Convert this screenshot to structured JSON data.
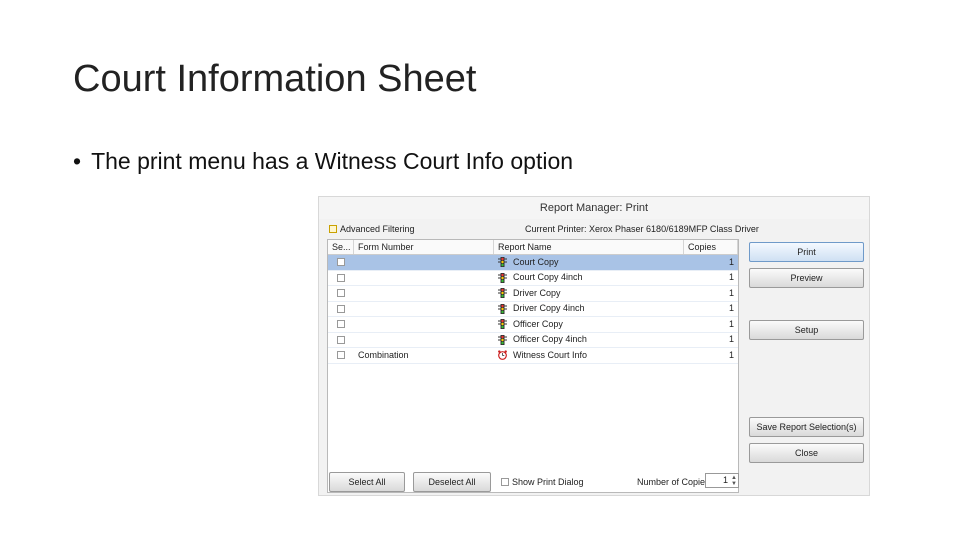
{
  "slide": {
    "title": "Court Information Sheet",
    "bullet": "The print menu has a Witness Court Info option"
  },
  "window": {
    "title": "Report Manager: Print",
    "advanced_filtering": "Advanced Filtering",
    "current_printer": "Current Printer: Xerox Phaser 6180/6189MFP Class Driver",
    "columns": [
      "Se...",
      "Form Number",
      "Report Name",
      "Copies"
    ],
    "rows": [
      {
        "form": "",
        "name": "Court Copy",
        "copies": "1",
        "icon": "traffic-light-icon",
        "selected": true
      },
      {
        "form": "",
        "name": "Court Copy 4inch",
        "copies": "1",
        "icon": "traffic-light-icon",
        "selected": false
      },
      {
        "form": "",
        "name": "Driver Copy",
        "copies": "1",
        "icon": "traffic-light-icon",
        "selected": false
      },
      {
        "form": "",
        "name": "Driver Copy 4inch",
        "copies": "1",
        "icon": "traffic-light-icon",
        "selected": false
      },
      {
        "form": "",
        "name": "Officer Copy",
        "copies": "1",
        "icon": "traffic-light-icon",
        "selected": false
      },
      {
        "form": "",
        "name": "Officer Copy 4inch",
        "copies": "1",
        "icon": "traffic-light-icon",
        "selected": false
      },
      {
        "form": "Combination",
        "name": "Witness Court Info",
        "copies": "1",
        "icon": "alarm-clock-icon",
        "selected": false
      }
    ],
    "buttons": {
      "print": "Print",
      "preview": "Preview",
      "setup": "Setup",
      "save_selection": "Save Report Selection(s)",
      "close": "Close",
      "select_all": "Select All",
      "deselect_all": "Deselect All"
    },
    "show_print_dialog": "Show Print Dialog",
    "number_of_copies_label": "Number of Copies",
    "number_of_copies_value": "1",
    "colors": {
      "selected_row": "#a9c3e6",
      "primary_button_border": "#6f9ac9"
    }
  }
}
